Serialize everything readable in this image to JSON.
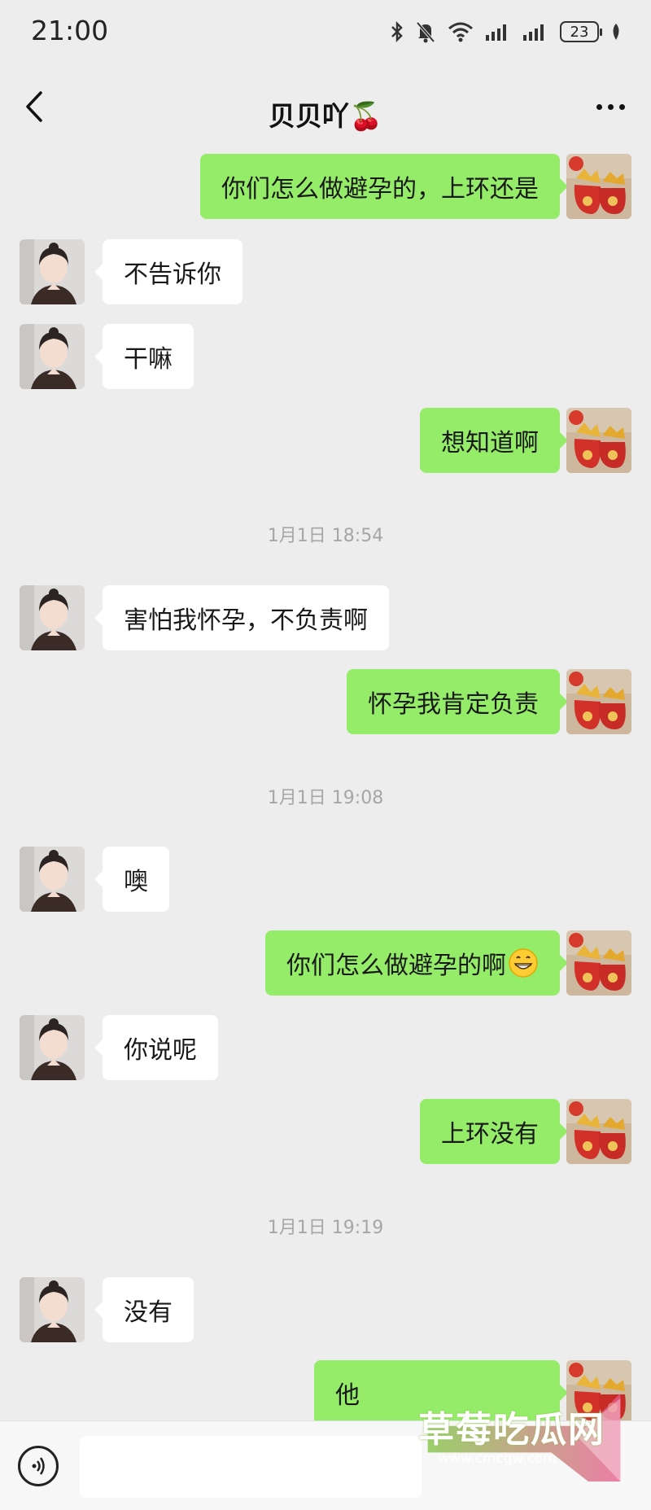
{
  "status_bar": {
    "time": "21:00",
    "battery": "23",
    "icons": [
      "bluetooth-icon",
      "mute-bell-icon",
      "wifi-icon",
      "signal-icon",
      "signal-icon",
      "battery-icon",
      "leaf-icon"
    ]
  },
  "header": {
    "title": "贝贝吖🍒",
    "back_icon": "chevron-left-icon",
    "more_icon": "more-dots-icon"
  },
  "messages": [
    {
      "side": "right",
      "text": "你们怎么做避孕的，上环还是"
    },
    {
      "side": "left",
      "text": "不告诉你"
    },
    {
      "side": "left",
      "text": "干嘛"
    },
    {
      "side": "right",
      "text": "想知道啊"
    },
    {
      "type": "time",
      "text": "1月1日 18:54"
    },
    {
      "side": "left",
      "text": "害怕我怀孕，不负责啊"
    },
    {
      "side": "right",
      "text": "怀孕我肯定负责"
    },
    {
      "type": "time",
      "text": "1月1日 19:08"
    },
    {
      "side": "left",
      "text": "噢"
    },
    {
      "side": "right",
      "text": "你们怎么做避孕的啊",
      "emoji": "grinning-face-icon"
    },
    {
      "side": "left",
      "text": "你说呢"
    },
    {
      "side": "right",
      "text": "上环没有"
    },
    {
      "type": "time",
      "text": "1月1日 19:19"
    },
    {
      "side": "left",
      "text": "没有"
    },
    {
      "side": "right",
      "text": "他"
    }
  ],
  "input_bar": {
    "voice_icon": "voice-icon",
    "placeholder": ""
  },
  "watermark": {
    "title": "草莓吃瓜网",
    "url": "www.cmcgw.com"
  },
  "colors": {
    "background": "#ededed",
    "bubble_self": "#95ec69",
    "bubble_other": "#ffffff",
    "time_text": "#a6a6a6"
  }
}
